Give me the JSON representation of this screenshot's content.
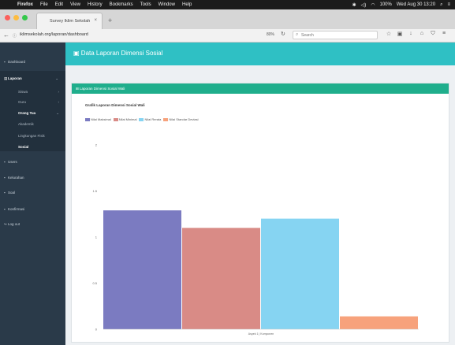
{
  "menubar": {
    "app": "Firefox",
    "items": [
      "File",
      "Edit",
      "View",
      "History",
      "Bookmarks",
      "Tools",
      "Window",
      "Help"
    ],
    "status": [
      "100%",
      "Wed Aug 30 13:20"
    ]
  },
  "browser": {
    "tab_title": "Survey Iklim Sekolah",
    "url": "iklimsekolah.org/laporan/dashboard",
    "zoom": "80%",
    "search_placeholder": "Search"
  },
  "sidebar": {
    "items": [
      {
        "label": "Dashboard"
      },
      {
        "label": "Laporan"
      },
      {
        "label": "Users"
      },
      {
        "label": "Kelurahan"
      },
      {
        "label": "Soal"
      },
      {
        "label": "Konfirmasi"
      },
      {
        "label": "Log out"
      }
    ],
    "subitems": [
      {
        "label": "Siswa"
      },
      {
        "label": "Guru"
      },
      {
        "label": "Orang Tua"
      },
      {
        "label": "Akademik"
      },
      {
        "label": "Lingkungan Fisik"
      },
      {
        "label": "Sosial"
      }
    ]
  },
  "header": {
    "title": "Data Laporan Dimensi Sosial"
  },
  "panel": {
    "title": "Laporan Dimensi Sosial Wali"
  },
  "colors": {
    "menubar": "#1c1c1c",
    "sidebar": "#2a3a49",
    "header": "#2fc0c4",
    "panel_header": "#1fae8c"
  },
  "chart_data": {
    "type": "bar",
    "title": "Grafik Laporan Dimensi Sosial Wali",
    "categories": [
      "Aspek 1 | Komponen"
    ],
    "series": [
      {
        "name": "Nilai Maksimal",
        "values": [
          1.29
        ],
        "color": "#7b7bc1"
      },
      {
        "name": "Nilai Minimal",
        "values": [
          1.1
        ],
        "color": "#d98b86"
      },
      {
        "name": "Nilai Rerata",
        "values": [
          1.2
        ],
        "color": "#86d4f2"
      },
      {
        "name": "Nilai Standar Deviasi",
        "values": [
          0.14
        ],
        "color": "#f7a27c"
      }
    ],
    "y_ticks": [
      "2",
      "1.5",
      "1",
      "0.5",
      "0"
    ],
    "ylim": [
      0,
      2
    ],
    "grid": false,
    "legend": "top-left"
  }
}
